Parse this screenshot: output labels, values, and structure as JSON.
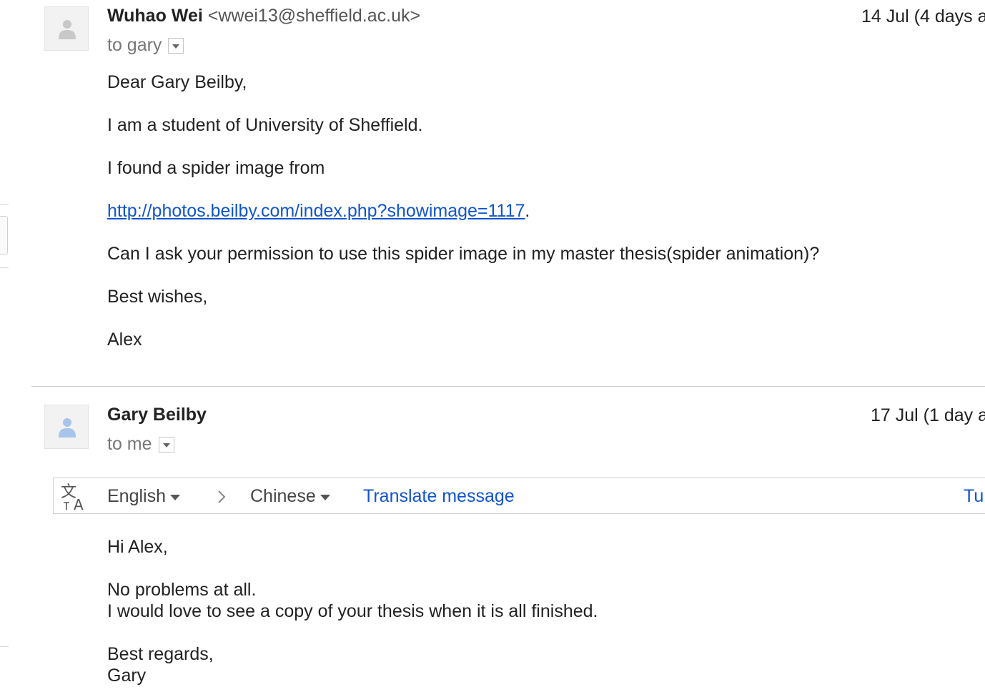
{
  "messages": [
    {
      "sender_name": "Wuhao Wei",
      "sender_email": "<wwei13@sheffield.ac.uk>",
      "date": "14 Jul (4 days a",
      "recipient": "to gary",
      "body": {
        "greeting": "Dear Gary Beilby,",
        "line1": "I am a student of University of Sheffield.",
        "line2": "I found a spider image from",
        "link": "http://photos.beilby.com/index.php?showimage=1117",
        "link_suffix": ".",
        "line3": "Can I ask your permission to use this spider image in my master thesis(spider animation)?",
        "closing": "Best wishes,",
        "signature": "Alex"
      }
    },
    {
      "sender_name": "Gary Beilby",
      "date": "17 Jul (1 day a",
      "recipient": "to me",
      "body": {
        "greeting": "Hi Alex,",
        "line1": "No problems at all.",
        "line2": "I would love to see a copy of your thesis when it is all finished.",
        "closing": "Best regards,",
        "signature": "Gary"
      }
    }
  ],
  "translate_bar": {
    "source_language": "English",
    "target_language": "Chinese",
    "translate_link": "Translate message",
    "right_link": "Tu"
  },
  "colors": {
    "link": "#1155cc",
    "avatar_gray": "#c8c8c8",
    "avatar_blue": "#a7c4ea"
  }
}
